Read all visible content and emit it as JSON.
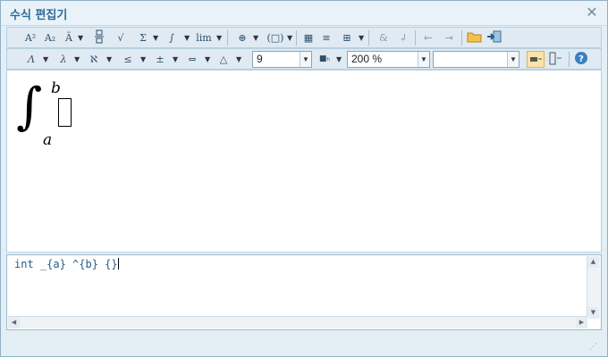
{
  "window": {
    "title": "수식 편집기",
    "close_icon": "close-icon"
  },
  "toolbar1": {
    "buttons": [
      {
        "name": "superscript-button",
        "glyph": "A²"
      },
      {
        "name": "subscript-button",
        "glyph": "A₂"
      },
      {
        "name": "accent-button",
        "glyph": "Ã"
      },
      {
        "name": "fraction-button",
        "glyph": "─"
      },
      {
        "name": "root-button",
        "glyph": "√"
      },
      {
        "name": "sum-button",
        "glyph": "Σ"
      },
      {
        "name": "integral-button",
        "glyph": "∫"
      },
      {
        "name": "limit-button",
        "glyph": "lim"
      },
      {
        "name": "matrix-layout-button",
        "glyph": "⊕"
      },
      {
        "name": "bracket-button",
        "glyph": "(□)"
      },
      {
        "name": "grid-button",
        "glyph": "▦"
      },
      {
        "name": "list-button",
        "glyph": "≡"
      },
      {
        "name": "table-button",
        "glyph": "⊞"
      },
      {
        "name": "ampersand-button",
        "glyph": "&"
      },
      {
        "name": "newline-button",
        "glyph": "↲"
      },
      {
        "name": "prev-button",
        "glyph": "⇤"
      },
      {
        "name": "next-button",
        "glyph": "⇥"
      },
      {
        "name": "open-folder-button",
        "glyph": "▣"
      },
      {
        "name": "insert-button",
        "glyph": "⇨"
      }
    ]
  },
  "toolbar2": {
    "buttons": [
      {
        "name": "greek-upper-button",
        "glyph": "Λ"
      },
      {
        "name": "greek-lower-button",
        "glyph": "λ"
      },
      {
        "name": "hebrew-button",
        "glyph": "ℵ"
      },
      {
        "name": "relation-button",
        "glyph": "≤"
      },
      {
        "name": "operator-button",
        "glyph": "±"
      },
      {
        "name": "arrow-button",
        "glyph": "⇔"
      },
      {
        "name": "misc-symbol-button",
        "glyph": "△"
      }
    ],
    "font_size": "9",
    "zoom": "200 %",
    "font_select": "",
    "color_label": "■ₕ",
    "help_icon": "?"
  },
  "preview": {
    "integral": "∫",
    "upper": "b",
    "lower": "a"
  },
  "editor": {
    "source": "int _{a} ^{b} {}"
  }
}
